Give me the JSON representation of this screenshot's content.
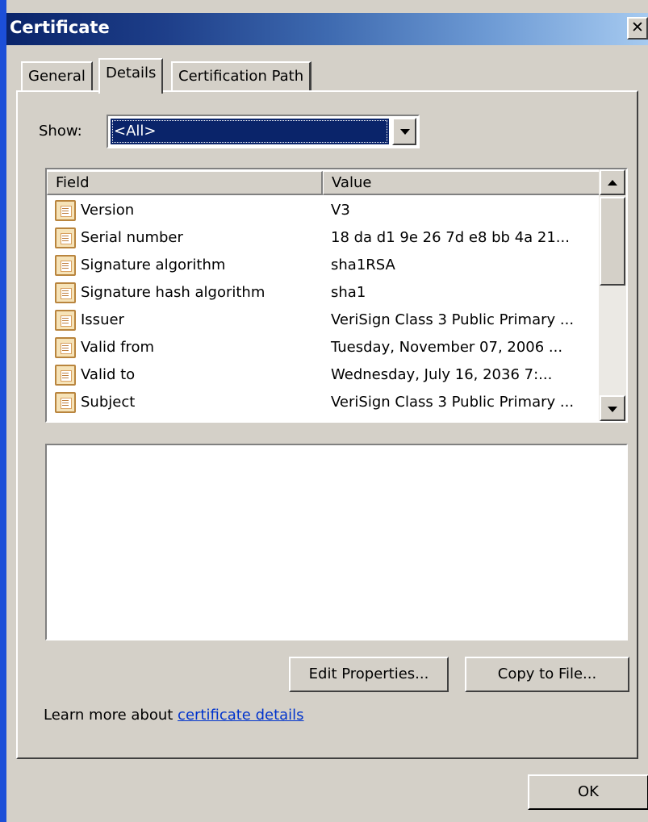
{
  "window": {
    "title": "Certificate",
    "close_glyph": "✕"
  },
  "tabs": [
    {
      "label": "General",
      "active": false
    },
    {
      "label": "Details",
      "active": true
    },
    {
      "label": "Certification Path",
      "active": false
    }
  ],
  "show": {
    "label": "Show:",
    "value": "<All>"
  },
  "table": {
    "headers": {
      "field": "Field",
      "value": "Value"
    },
    "rows": [
      {
        "field": "Version",
        "value": "V3"
      },
      {
        "field": "Serial number",
        "value": "18 da d1 9e 26 7d e8 bb 4a 21..."
      },
      {
        "field": "Signature algorithm",
        "value": "sha1RSA"
      },
      {
        "field": "Signature hash algorithm",
        "value": "sha1"
      },
      {
        "field": "Issuer",
        "value": "VeriSign Class 3 Public Primary ..."
      },
      {
        "field": "Valid from",
        "value": "Tuesday, November 07, 2006 ..."
      },
      {
        "field": "Valid to",
        "value": "Wednesday, July 16, 2036 7:..."
      },
      {
        "field": "Subject",
        "value": "VeriSign Class 3 Public Primary ..."
      }
    ]
  },
  "buttons": {
    "edit": "Edit Properties...",
    "copy": "Copy to File...",
    "ok": "OK"
  },
  "learn": {
    "prefix": "Learn more about ",
    "link": "certificate details"
  },
  "icons": {
    "row_icon": "certificate-field-icon",
    "dropdown": "chevron-down-icon",
    "scroll_up": "arrow-up-icon",
    "scroll_down": "arrow-down-icon"
  },
  "colors": {
    "titlebar_start": "#0a246a",
    "titlebar_end": "#a6caf0",
    "selection": "#0a246a",
    "dialog_bg": "#d4d0c8",
    "link": "#0033cc"
  }
}
